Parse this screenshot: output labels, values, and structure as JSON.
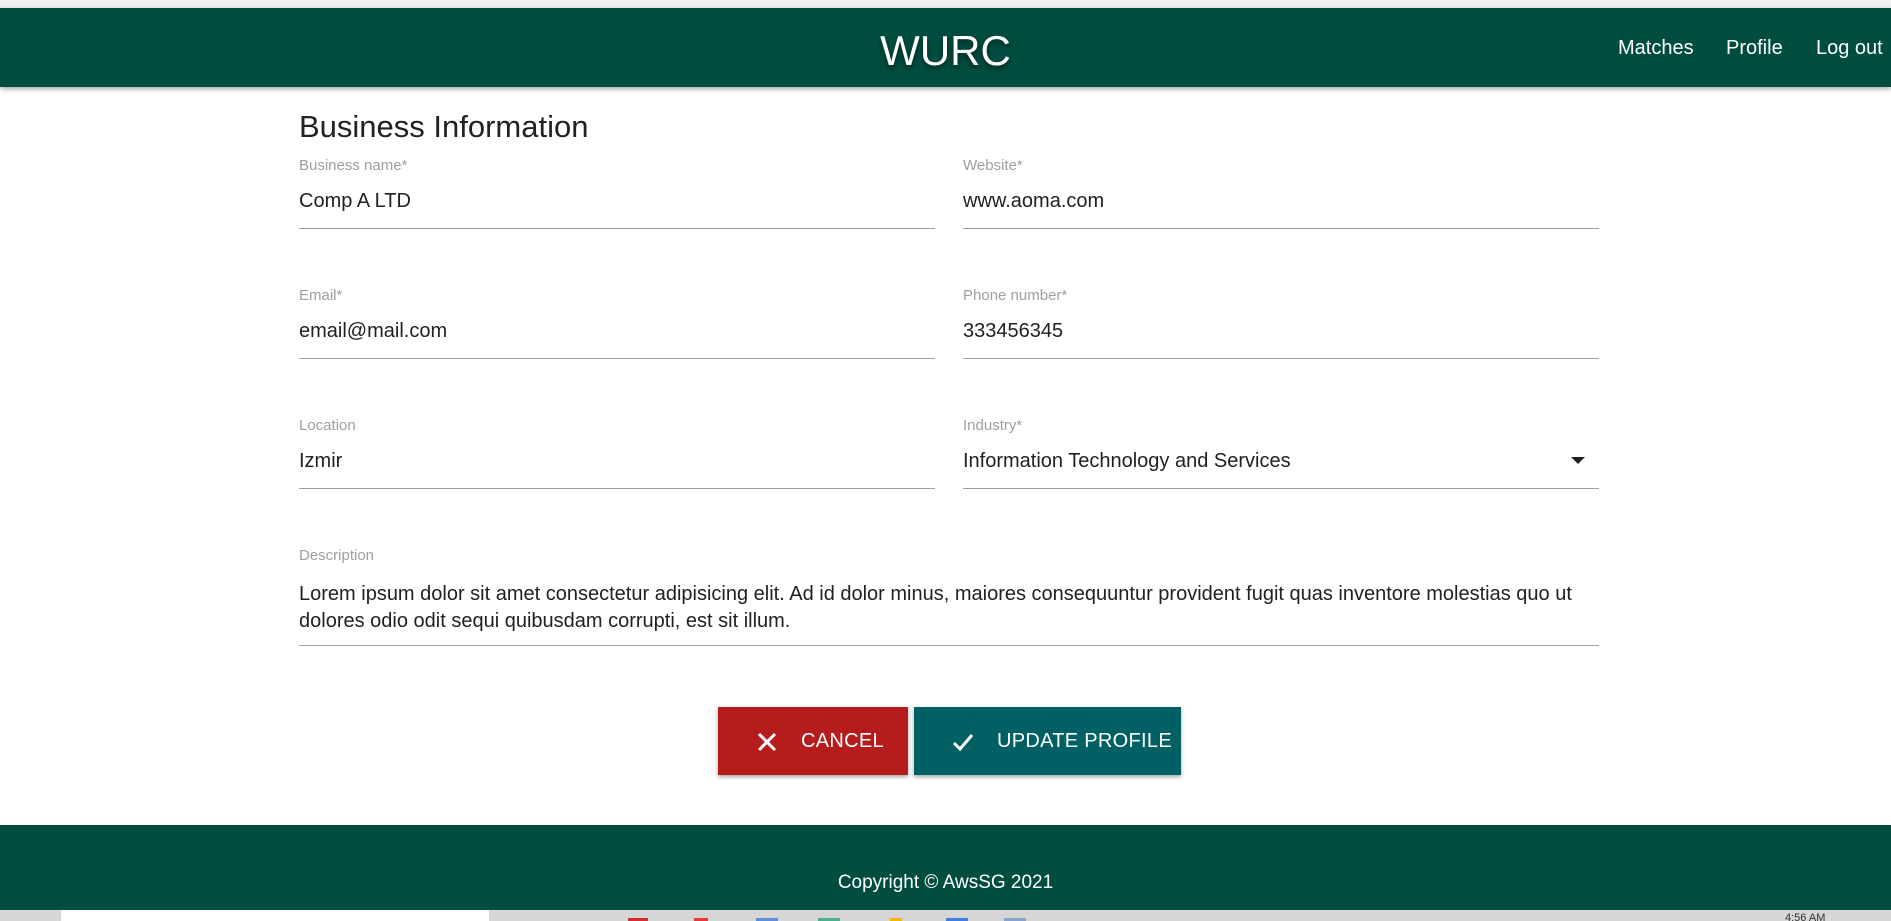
{
  "navbar": {
    "brand": "WURC",
    "links": {
      "matches": "Matches",
      "profile": "Profile",
      "logout": "Log out"
    }
  },
  "form": {
    "title": "Business Information",
    "business_name": {
      "label": "Business name*",
      "value": "Comp A LTD"
    },
    "website": {
      "label": "Website*",
      "value": "www.aoma.com"
    },
    "email": {
      "label": "Email*",
      "value": "email@mail.com"
    },
    "phone": {
      "label": "Phone number*",
      "value": "333456345"
    },
    "location": {
      "label": "Location",
      "value": "Izmir"
    },
    "industry": {
      "label": "Industry*",
      "value": "Information Technology and Services"
    },
    "description": {
      "label": "Description",
      "value": "Lorem ipsum dolor sit amet consectetur adipisicing elit. Ad id dolor minus, maiores consequuntur provident fugit quas inventore molestias quo ut dolores odio odit sequi quibusdam corrupti, est sit illum."
    }
  },
  "actions": {
    "cancel_label": "CANCEL",
    "update_label": "UPDATE PROFILE"
  },
  "footer": {
    "copyright": "Copyright © AwsSG 2021"
  },
  "taskbar": {
    "clock": "4:56 AM"
  },
  "icons": {
    "cancel": "close-icon",
    "update": "check-icon",
    "industry": "dropdown-arrow-icon"
  },
  "colors": {
    "primary": "#004d40",
    "cancel": "#b71c1c",
    "update": "#006064"
  }
}
